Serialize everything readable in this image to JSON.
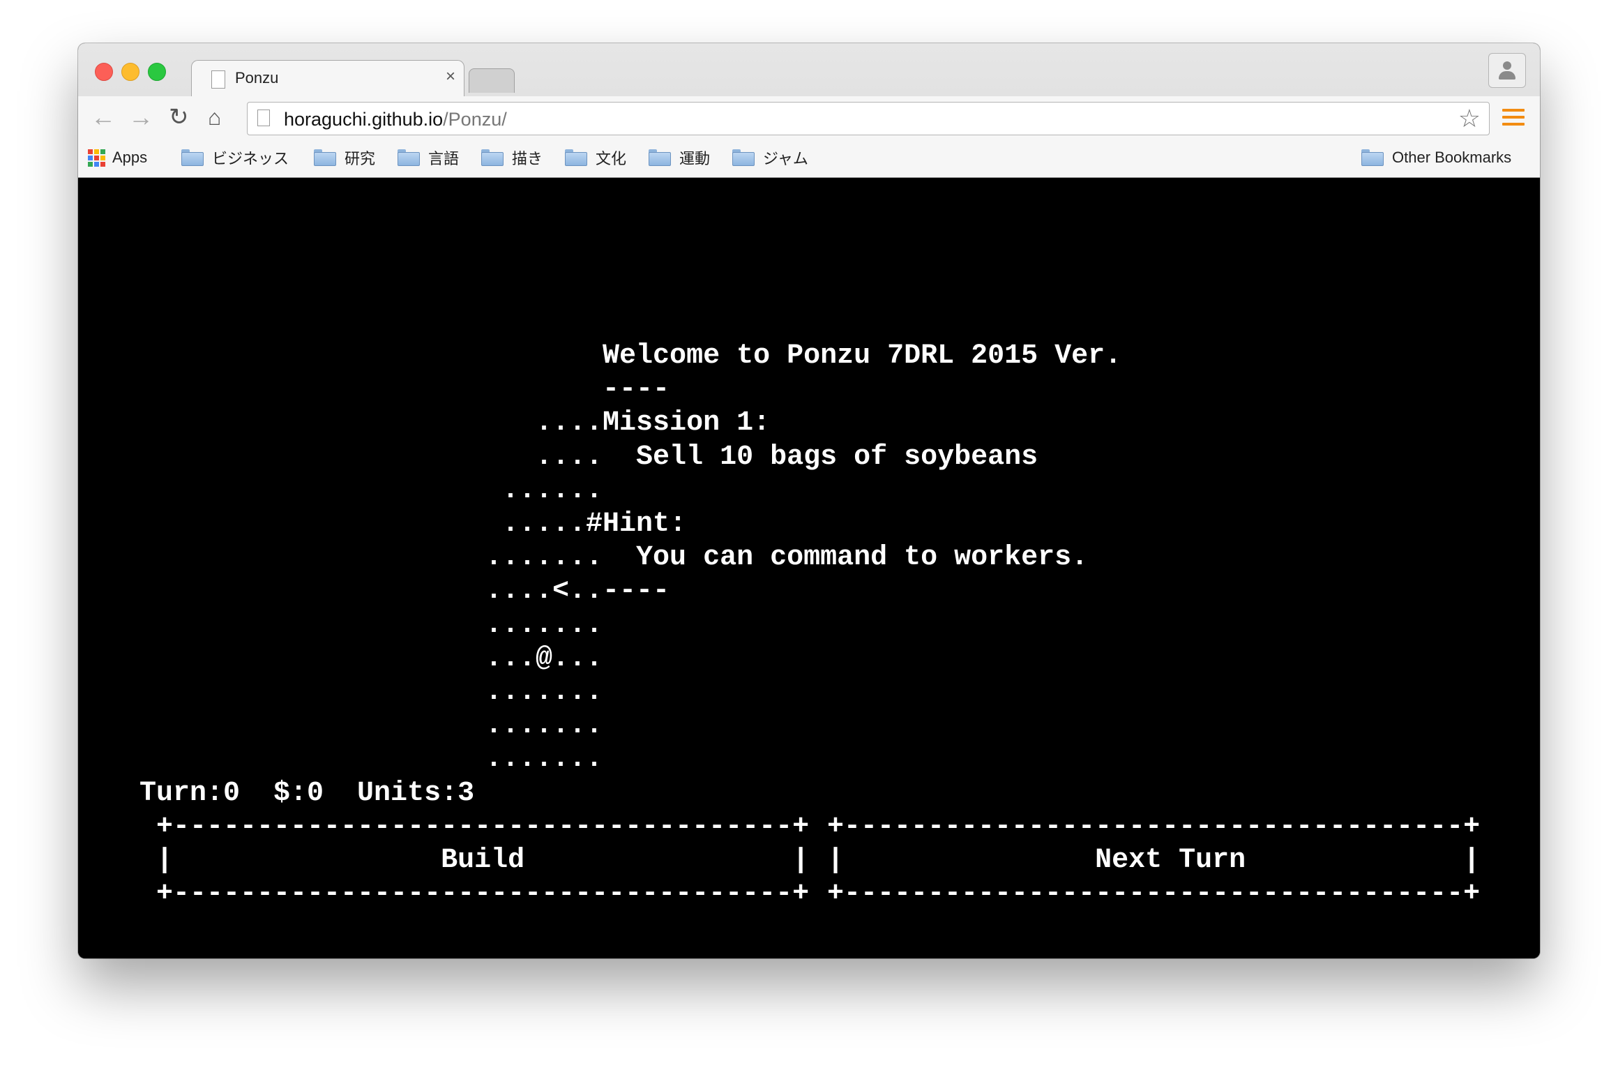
{
  "tab": {
    "title": "Ponzu",
    "close": "×"
  },
  "address": {
    "host": "horaguchi.github.io",
    "path": "/Ponzu/"
  },
  "bookmarks": {
    "apps": "Apps",
    "folders": [
      "ビジネッス",
      "研究",
      "言語",
      "描き",
      "文化",
      "運動",
      "ジャム"
    ],
    "other": "Other Bookmarks"
  },
  "game": {
    "lines": [
      "           Welcome to Ponzu 7DRL 2015 Ver.",
      "           ----",
      "       ....Mission 1:",
      "       ....  Sell 10 bags of soybeans",
      "     ......",
      "     .....#Hint:",
      "    .......  You can command to workers.",
      "    ....<..----",
      "    .......",
      "    ...@...",
      "    .......",
      "    .......",
      "    ......."
    ],
    "status": "Turn:0  $:0  Units:3",
    "buttons": {
      "build": {
        "top": " +-------------------------------------+",
        "label": " |                Build                |",
        "bottom": " +-------------------------------------+"
      },
      "next_turn": {
        "top": "+-------------------------------------+",
        "label": "|               Next Turn             |",
        "bottom": "+-------------------------------------+"
      }
    }
  }
}
